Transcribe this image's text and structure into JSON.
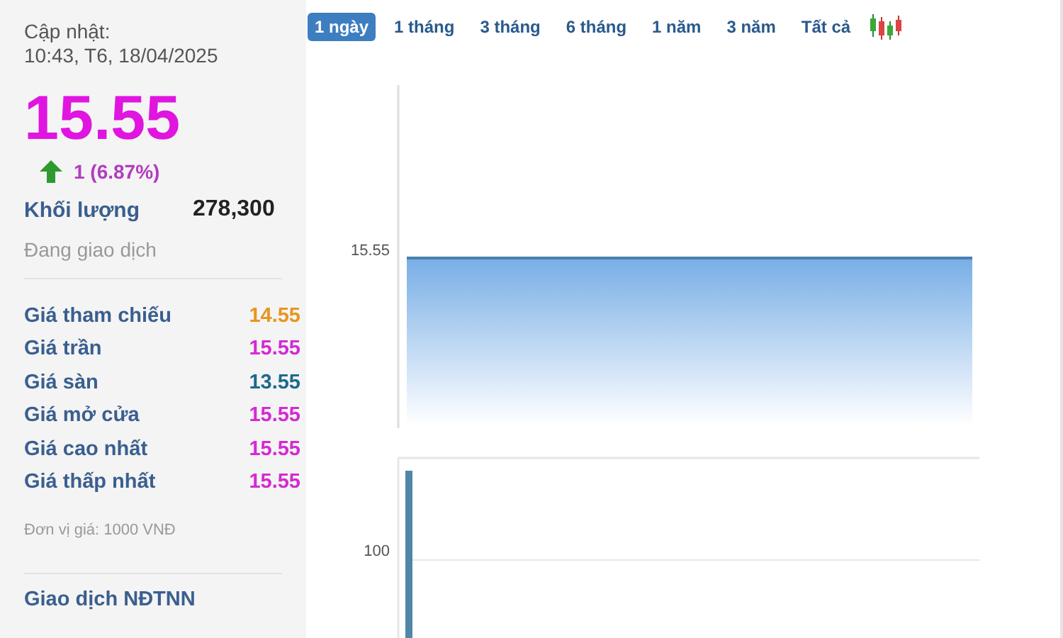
{
  "update": {
    "label": "Cập nhật:",
    "time": "10:43, T6, 18/04/2025"
  },
  "price": "15.55",
  "change": {
    "up": true,
    "text": "1 (6.87%)"
  },
  "volume": {
    "label": "Khối lượng",
    "value": "278,300"
  },
  "trading_status": "Đang giao dịch",
  "price_rows": [
    {
      "label": "Giá tham chiếu",
      "value": "14.55",
      "color": "#e8961e"
    },
    {
      "label": "Giá trần",
      "value": "15.55",
      "color": "#d42ad4"
    },
    {
      "label": "Giá sàn",
      "value": "13.55",
      "color": "#1e6a8c"
    },
    {
      "label": "Giá mở cửa",
      "value": "15.55",
      "color": "#d42ad4"
    },
    {
      "label": "Giá cao nhất",
      "value": "15.55",
      "color": "#d42ad4"
    },
    {
      "label": "Giá thấp nhất",
      "value": "15.55",
      "color": "#d42ad4"
    }
  ],
  "unit_note": "Đơn vị giá: 1000 VNĐ",
  "foreign_section": "Giao dịch NĐTNN",
  "range_tabs": [
    {
      "label": "1 ngày",
      "selected": true
    },
    {
      "label": "1 tháng",
      "selected": false
    },
    {
      "label": "3 tháng",
      "selected": false
    },
    {
      "label": "6 tháng",
      "selected": false
    },
    {
      "label": "1 năm",
      "selected": false
    },
    {
      "label": "3 năm",
      "selected": false
    },
    {
      "label": "Tất cả",
      "selected": false
    }
  ],
  "price_chart": {
    "axis_label": "15.55"
  },
  "volume_chart": {
    "axis_label": "100"
  }
}
